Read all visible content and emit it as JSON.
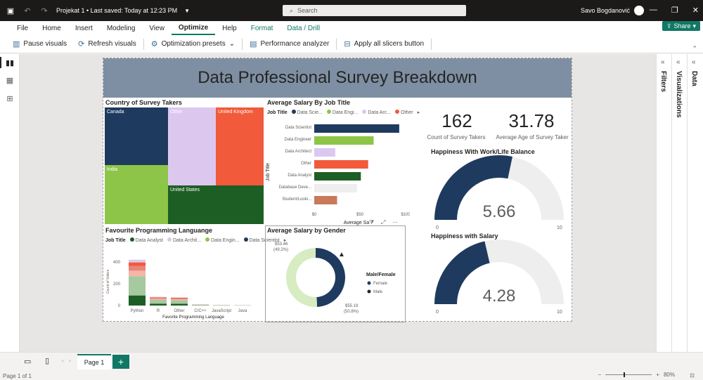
{
  "titlebar": {
    "doc_title": "Projekat 1 • Last saved: Today at 12:23 PM",
    "search_placeholder": "Search",
    "user_name": "Savo Bogdanović"
  },
  "menu": [
    "File",
    "Home",
    "Insert",
    "Modeling",
    "View",
    "Optimize",
    "Help",
    "Format",
    "Data / Drill"
  ],
  "active_menu": "Optimize",
  "share_label": "Share",
  "toolbar": {
    "pause": "Pause visuals",
    "refresh": "Refresh visuals",
    "presets": "Optimization presets",
    "perf": "Performance analyzer",
    "slicers": "Apply all slicers button"
  },
  "panes": {
    "filters": "Filters",
    "visualizations": "Visualizations",
    "data": "Data"
  },
  "report": {
    "title": "Data Professional Survey Breakdown",
    "treemap_title": "Country of Survey Takers",
    "salary_job_title": "Average Salary By Job Title",
    "prog_lang_title": "Favourite Programming Languange",
    "gender_title": "Average Salary by Gender",
    "kpi_count_value": "162",
    "kpi_count_label": "Count of Survey Takers",
    "kpi_age_value": "31.78",
    "kpi_age_label": "Average Age of Survey Taker",
    "gauge1_title": "Happiness With Work/Life Balance",
    "gauge2_title": "Happiness with Salary",
    "job_legend_label": "Job Title",
    "job_legend_items": [
      "Data Scie...",
      "Data Engi...",
      "Data Arc...",
      "Other"
    ],
    "lang_legend_items": [
      "Data Analyst",
      "Data Archit...",
      "Data Engin...",
      "Data Scientist"
    ],
    "gender_legend_label": "Male/Female",
    "gender_legend_items": [
      "Female",
      "Male"
    ],
    "treemap_labels": [
      "Canada",
      "Other",
      "United Kingdom",
      "India",
      "United States"
    ],
    "axis_job_title": "Job Title",
    "axis_avg_salary": "Average Sa",
    "axis_count_voters": "Count of Voters",
    "axis_fav_lang": "Favorite Programming Language",
    "gender_label_female_val": "$53.46",
    "gender_label_female_pct": "(49.2%)",
    "gender_label_male_val": "$55.19",
    "gender_label_male_pct": "(50.8%)",
    "gauge_min": "0",
    "gauge_max": "10"
  },
  "pages": {
    "tab": "Page 1",
    "status": "Page 1 of 1",
    "zoom": "80%"
  },
  "chart_data": [
    {
      "type": "bar",
      "title": "Average Salary By Job Title",
      "ylabel": "Job Title",
      "xlabel": "Average Sa",
      "categories": [
        "Data Scientist",
        "Data Engineer",
        "Data Architect",
        "Other",
        "Data Analyst",
        "Database Deve...",
        "Student/Looki..."
      ],
      "values": [
        93,
        65,
        23,
        59,
        51,
        47,
        25
      ],
      "colors": [
        "#1f3a5f",
        "#8dc548",
        "#dcc8ef",
        "#f15a3a",
        "#1d5e24",
        "#eeeeee",
        "#c97a5a"
      ],
      "xticks": [
        "$0",
        "$50",
        "$100"
      ],
      "xlim": [
        0,
        100
      ]
    },
    {
      "type": "bar",
      "title": "Favourite Programming Languange",
      "xlabel": "Favorite Programming Language",
      "ylabel": "Count of Voters",
      "categories": [
        "Python",
        "R",
        "Other",
        "C/C++",
        "JavaScript",
        "Java"
      ],
      "values": [
        420,
        80,
        75,
        10,
        6,
        4
      ],
      "yticks": [
        "0",
        "200",
        "400"
      ],
      "ylim": [
        0,
        450
      ]
    },
    {
      "type": "pie",
      "title": "Average Salary by Gender",
      "categories": [
        "Female",
        "Male"
      ],
      "values": [
        53.46,
        55.19
      ],
      "colors": [
        "#1f3a5f",
        "#d7ecc0"
      ]
    },
    {
      "type": "gauge",
      "title": "Happiness With Work/Life Balance",
      "value": 5.66,
      "min": 0,
      "max": 10,
      "display": "5.66"
    },
    {
      "type": "gauge",
      "title": "Happiness with Salary",
      "value": 4.28,
      "min": 0,
      "max": 10,
      "display": "4.28"
    }
  ],
  "colors": {
    "accent": "#117865",
    "navy": "#1f3a5f",
    "green_light": "#8dc548",
    "lavender": "#dcc8ef",
    "orange": "#f15a3a",
    "green_dark": "#1d5e24",
    "banner": "#7e8fa3"
  }
}
